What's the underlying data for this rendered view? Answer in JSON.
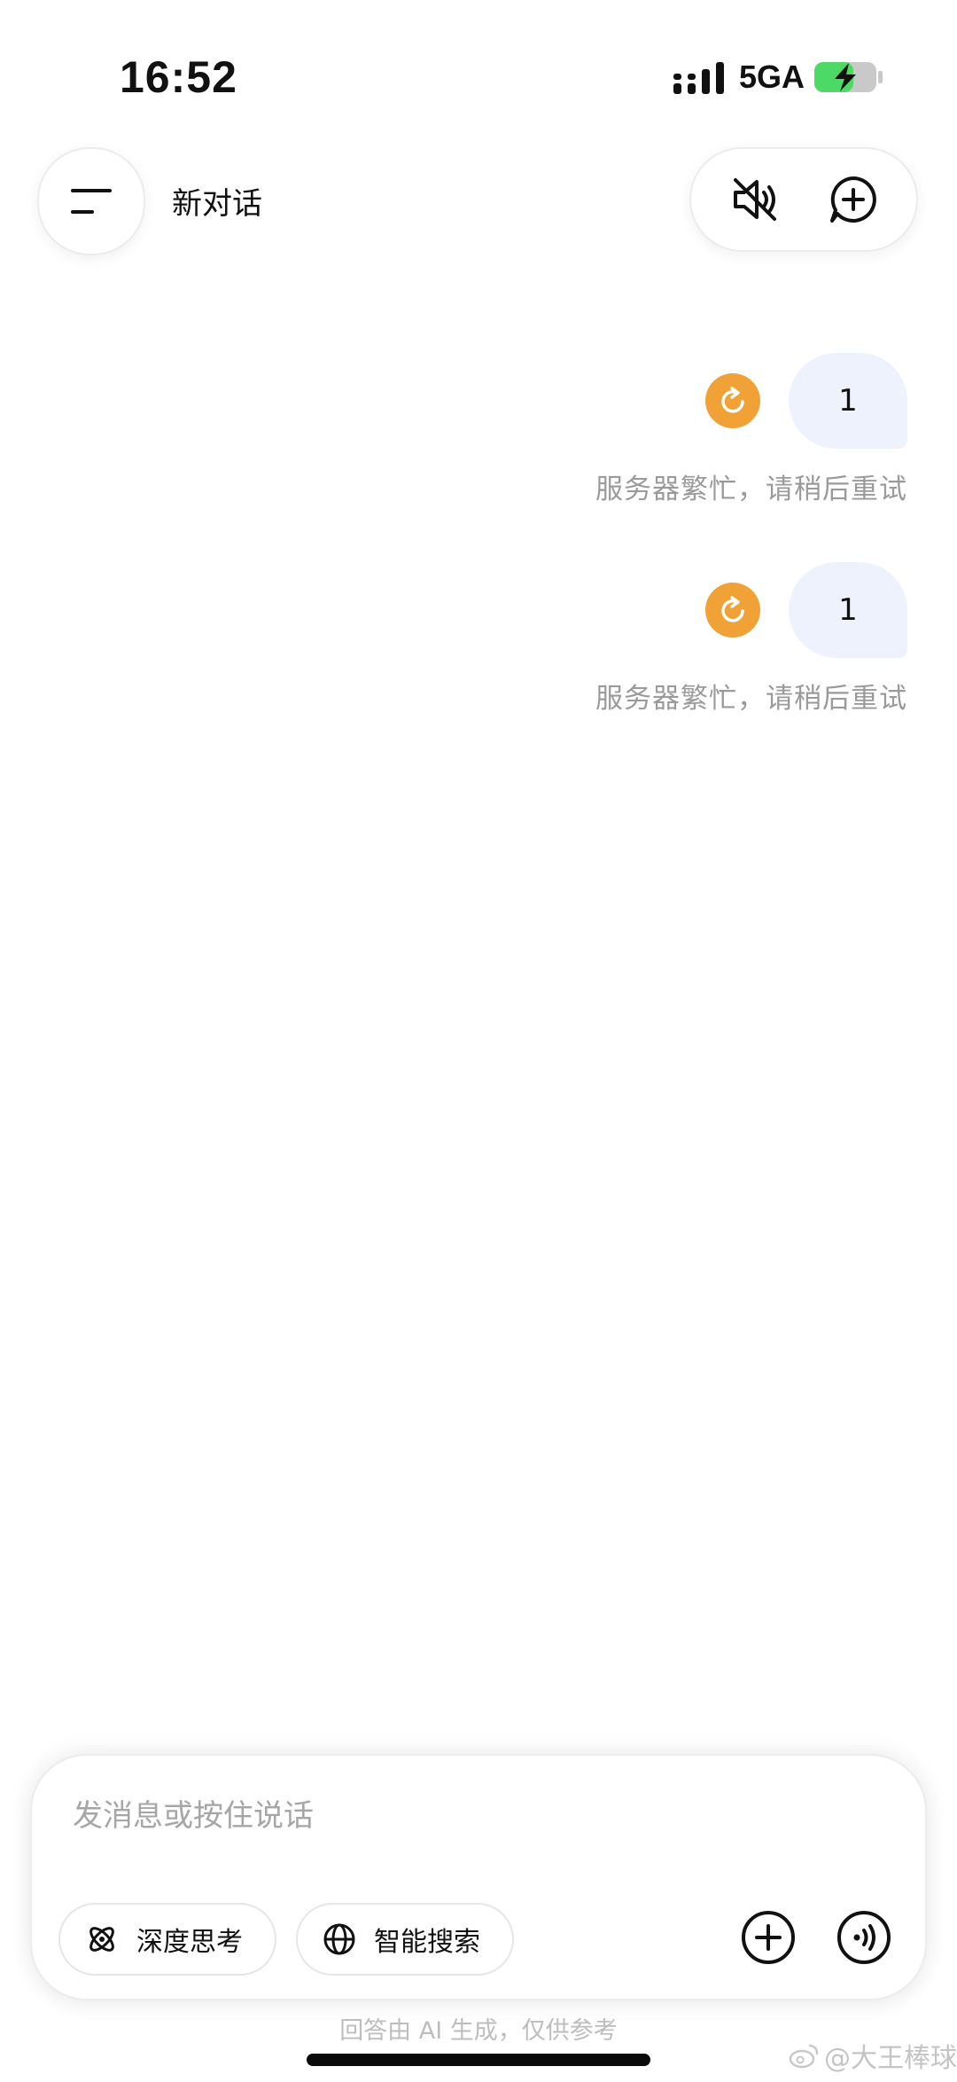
{
  "status_bar": {
    "time": "16:52",
    "network": "5GA",
    "battery_state": "charging",
    "accent_green": "#4cd964"
  },
  "header": {
    "title": "新对话",
    "menu_icon": "menu-icon",
    "mute_icon": "speaker-muted-icon",
    "new_chat_icon": "new-chat-icon"
  },
  "messages": [
    {
      "text": "1",
      "status": "服务器繁忙，请稍后重试",
      "retry_icon": "retry-icon"
    },
    {
      "text": "1",
      "status": "服务器繁忙，请稍后重试",
      "retry_icon": "retry-icon"
    }
  ],
  "composer": {
    "placeholder": "发消息或按住说话",
    "deep_think_label": "深度思考",
    "smart_search_label": "智能搜索",
    "add_icon": "plus-icon",
    "voice_icon": "voice-call-icon"
  },
  "disclaimer": "回答由 AI 生成，仅供参考",
  "watermark": "@大王棒球",
  "colors": {
    "retry_orange": "#f0a236",
    "bubble_bg": "#edf2fd",
    "muted_text": "#9a9a9a"
  }
}
